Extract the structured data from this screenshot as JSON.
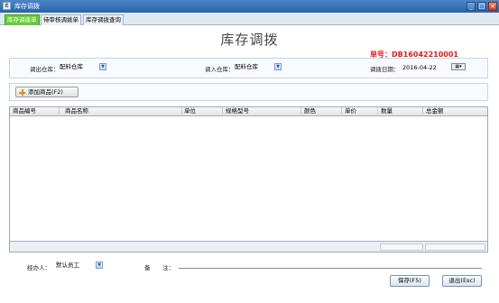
{
  "window": {
    "title": "库存调拨",
    "minimize_label": "_",
    "maximize_label": "□",
    "close_label": "×",
    "app_icon": "E"
  },
  "tabs": [
    {
      "label": "库存调拨单",
      "active": true
    },
    {
      "label": "待审核调拨单",
      "active": false
    },
    {
      "label": "库存调拨查询",
      "active": false
    }
  ],
  "form": {
    "title": "库存调拨",
    "doc_no_label": "单号：",
    "doc_no_value": "DB16042210001",
    "out_warehouse_label": "调出仓库：",
    "out_warehouse_value": "配料仓库",
    "in_warehouse_label": "调入仓库：",
    "in_warehouse_value": "配料仓库",
    "date_label": "调拨日期：",
    "date_value": "2016-04-22"
  },
  "toolbar": {
    "add_product_label": "添加商品(F2)"
  },
  "table": {
    "columns": [
      "商品编号",
      "商品名称",
      "单位",
      "规格型号",
      "颜色",
      "单价",
      "数量",
      "总金额"
    ],
    "rows": []
  },
  "footer": {
    "handler_label": "经办人：",
    "handler_value": "默认员工",
    "remark_label_1": "备",
    "remark_label_2": "注：",
    "remark_value": "",
    "save_label": "保存(F5)",
    "exit_label": "退出(Esc)"
  },
  "colors": {
    "active_tab": "#66cc33",
    "doc_no": "#e01818",
    "titlebar": "#2a64a8"
  }
}
